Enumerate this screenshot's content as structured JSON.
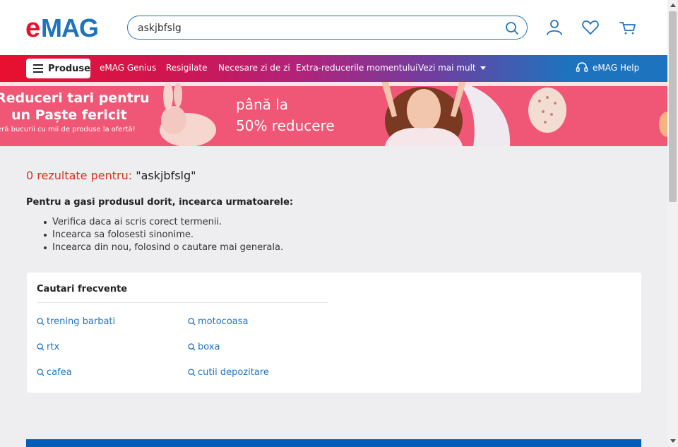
{
  "header": {
    "logo_text": "eMAG",
    "search": {
      "value": "askjbfslg",
      "placeholder": ""
    }
  },
  "nav": {
    "products_label": "Produse",
    "links": [
      "eMAG Genius",
      "Resigilate",
      "Necesare zi de zi",
      "Extra-reducerile momentului",
      "Vezi mai mult"
    ],
    "help_label": "eMAG Help"
  },
  "banner": {
    "line1": "Reduceri tari pentru",
    "line2": "un Paște fericit",
    "line3": "eră bucurii cu mii de produse la ofertă!",
    "line4": "până la",
    "line5": "50% reducere"
  },
  "results": {
    "count_text": "0 rezultate pentru:",
    "query_text": "\"askjbfslg\"",
    "tips_heading": "Pentru a gasi produsul dorit, incearca urmatoarele:",
    "tips": [
      "Verifica daca ai scris corect termenii.",
      "Incearca sa folosesti sinonime.",
      "Incearca din nou, folosind o cautare mai generala."
    ]
  },
  "frequent": {
    "heading": "Cautari frecvente",
    "items": [
      "trening barbati",
      "motocoasa",
      "rtx",
      "boxa",
      "cafea",
      "cutii depozitare"
    ]
  },
  "colors": {
    "brand_red": "#e8102e",
    "brand_blue": "#1e73be",
    "result_red": "#e0301e",
    "banner_pink": "#f05676"
  }
}
